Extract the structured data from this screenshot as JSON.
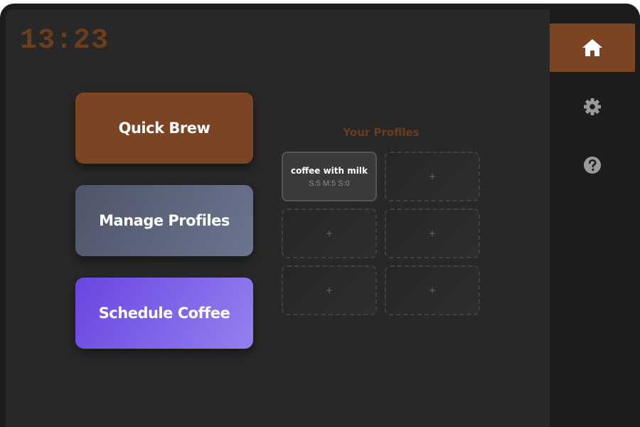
{
  "clock": {
    "time": "13:23"
  },
  "actions": {
    "quick_brew": "Quick Brew",
    "manage_profiles": "Manage Profiles",
    "schedule_coffee": "Schedule Coffee"
  },
  "profiles": {
    "title": "Your Profiles",
    "slots": [
      {
        "name": "coffee with milk",
        "settings": "S:5 M:5 S:0"
      },
      {
        "empty_label": "+"
      },
      {
        "empty_label": "+"
      },
      {
        "empty_label": "+"
      },
      {
        "empty_label": "+"
      },
      {
        "empty_label": "+"
      }
    ]
  },
  "nav": {
    "items": [
      {
        "icon": "home-icon",
        "active": true
      },
      {
        "icon": "gear-icon",
        "active": false
      },
      {
        "icon": "help-icon",
        "active": false
      }
    ]
  },
  "colors": {
    "accent": "#7b4423",
    "background": "#282828",
    "sidebar": "#1c1c1c",
    "clock": "#6b3d1b"
  }
}
